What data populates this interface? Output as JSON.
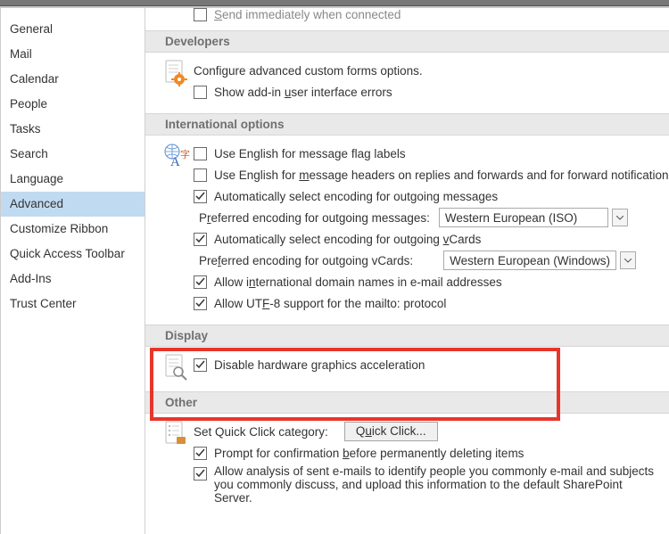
{
  "sidebar": {
    "items": [
      {
        "label": "General"
      },
      {
        "label": "Mail"
      },
      {
        "label": "Calendar"
      },
      {
        "label": "People"
      },
      {
        "label": "Tasks"
      },
      {
        "label": "Search"
      },
      {
        "label": "Language"
      },
      {
        "label": "Advanced"
      },
      {
        "label": "Customize Ribbon"
      },
      {
        "label": "Quick Access Toolbar"
      },
      {
        "label": "Add-Ins"
      },
      {
        "label": "Trust Center"
      }
    ],
    "selected_index": 7
  },
  "top_truncated": {
    "label_pre": "S",
    "label_post": "end immediately when connected"
  },
  "sections": {
    "developers": {
      "title": "Developers",
      "desc": "Configure advanced custom forms options.",
      "addin_pre": "Show add-in ",
      "addin_u": "u",
      "addin_post": "ser interface errors"
    },
    "intl": {
      "title": "International options",
      "opt1": "Use English for message flag labels",
      "opt2_pre": "Use English for ",
      "opt2_u": "m",
      "opt2_post": "essage headers on replies and forwards and for forward notification",
      "opt3": "Automatically select encoding for outgoing messages",
      "enc_out_pre": "P",
      "enc_out_u": "r",
      "enc_out_post": "eferred encoding for outgoing messages:",
      "enc_out_value": "Western European (ISO)",
      "opt4_pre": "Automatically select encoding for outgoing ",
      "opt4_u": "v",
      "opt4_post": "Cards",
      "enc_vcard_pre": "Pre",
      "enc_vcard_u": "f",
      "enc_vcard_post": "erred encoding for outgoing vCards:",
      "enc_vcard_value": "Western European (Windows)",
      "opt5_pre": "Allow i",
      "opt5_u": "n",
      "opt5_post": "ternational domain names in e-mail addresses",
      "opt6_pre": "Allow UT",
      "opt6_u": "F",
      "opt6_post": "-8 support for the mailto: protocol"
    },
    "display": {
      "title": "Display",
      "opt1": "Disable hardware graphics acceleration"
    },
    "other": {
      "title": "Other",
      "qc_label": "Set Quick Click category:",
      "qc_btn_pre": "Q",
      "qc_btn_u": "u",
      "qc_btn_post": "ick Click...",
      "opt1_pre": "Prompt for confirmation ",
      "opt1_u": "b",
      "opt1_post": "efore permanently deleting items",
      "opt2": "Allow analysis of sent e-mails to identify people you commonly e-mail and subjects you commonly discuss, and upload this information to the default SharePoint Server."
    }
  }
}
